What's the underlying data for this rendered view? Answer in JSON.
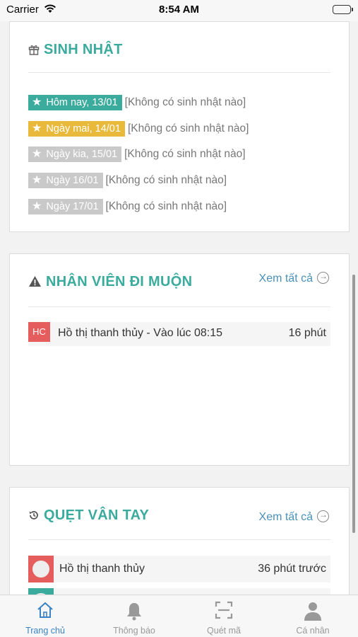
{
  "status_bar": {
    "carrier": "Carrier",
    "time": "8:54 AM"
  },
  "birthday": {
    "title": "SINH NHẬT",
    "rows": [
      {
        "tag": "Hôm nay, 13/01",
        "text": "[Không có sinh nhật nào]",
        "color": "#3aab9c"
      },
      {
        "tag": "Ngày mai, 14/01",
        "text": "[Không có sinh nhật nào]",
        "color": "#e8b93a"
      },
      {
        "tag": "Ngày kia, 15/01",
        "text": "[Không có sinh nhật nào]",
        "color": "#c9c9c9"
      },
      {
        "tag": "Ngày 16/01",
        "text": "[Không có sinh nhật nào]",
        "color": "#c9c9c9"
      },
      {
        "tag": "Ngày 17/01",
        "text": "[Không có sinh nhật nào]",
        "color": "#c9c9c9"
      }
    ]
  },
  "late": {
    "title": "NHÂN VIÊN ĐI MUỘN",
    "see_all": "Xem tất cả",
    "rows": [
      {
        "badge": "HC",
        "name": "Hồ thị thanh thủy - Vào lúc 08:15",
        "duration": "16 phút"
      }
    ]
  },
  "fingerprint": {
    "title": "QUẸT VÂN TAY",
    "see_all": "Xem tất cả",
    "rows": [
      {
        "name": "Hồ thị thanh thủy",
        "time": "36 phút trước"
      }
    ]
  },
  "tabs": [
    {
      "label": "Trang chủ",
      "icon": "home-icon",
      "active": true
    },
    {
      "label": "Thông báo",
      "icon": "bell-icon",
      "active": false
    },
    {
      "label": "Quét mã",
      "icon": "scan-icon",
      "active": false
    },
    {
      "label": "Cá nhân",
      "icon": "person-icon",
      "active": false
    }
  ],
  "colors": {
    "accent": "#3aab9c",
    "link": "#4a90b8",
    "tab_active": "#3a83c4",
    "late_badge": "#e55d5d"
  }
}
